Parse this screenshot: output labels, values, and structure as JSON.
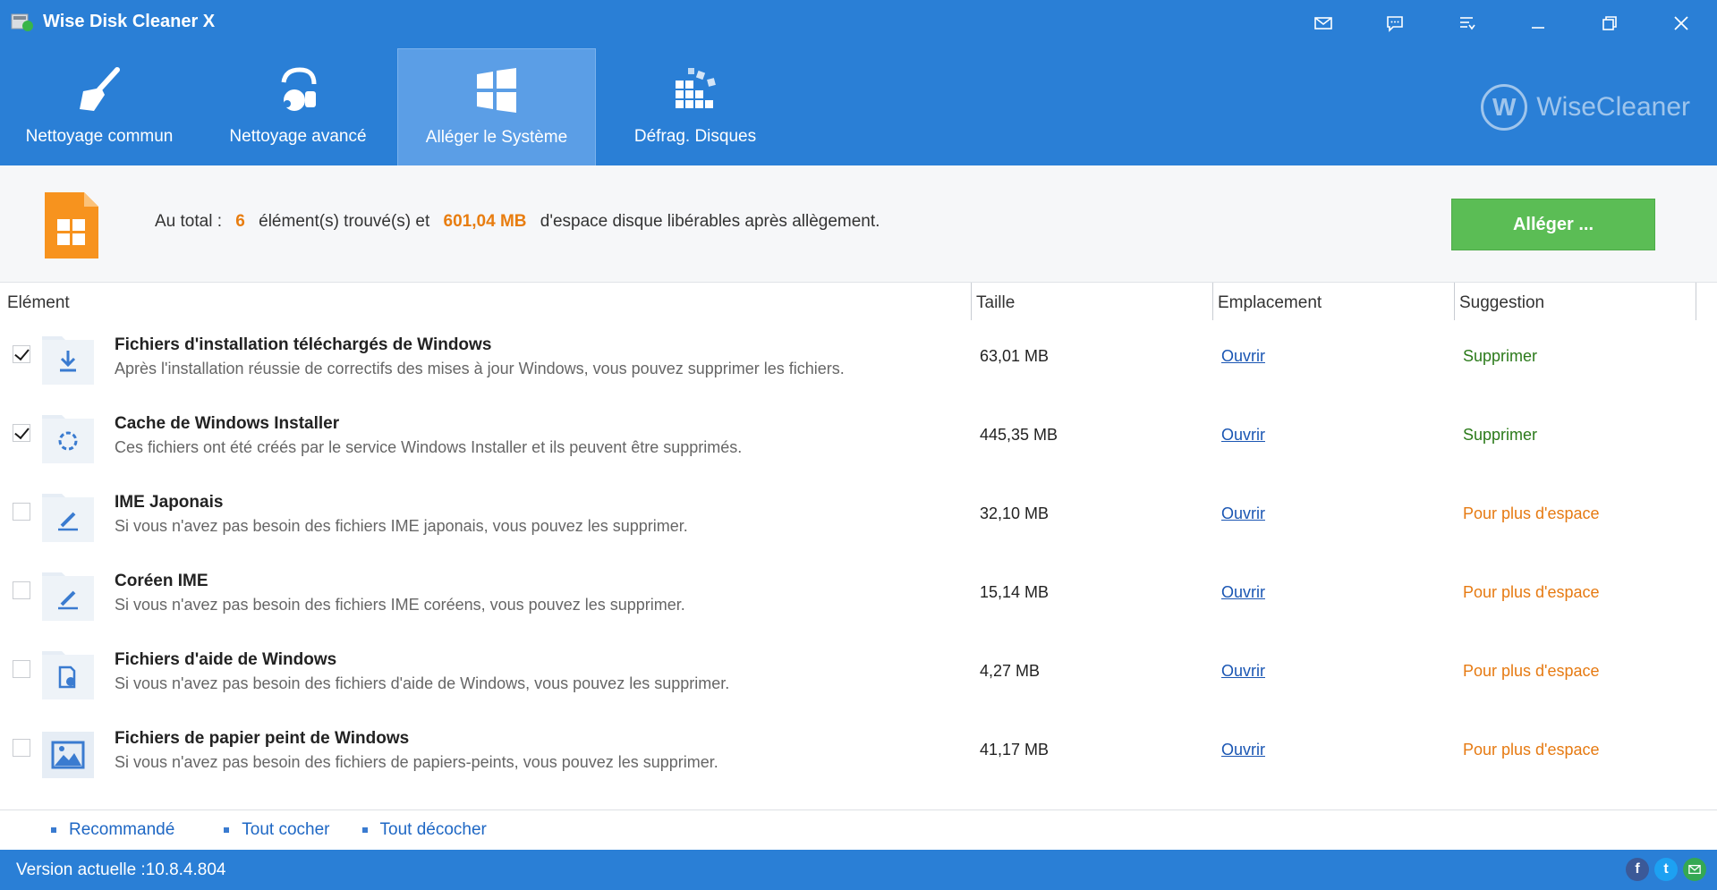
{
  "window": {
    "title": "Wise Disk Cleaner X",
    "controls": [
      "mail-icon",
      "feedback-icon",
      "menu-icon",
      "minimize-icon",
      "restore-icon",
      "close-icon"
    ]
  },
  "tabs": [
    {
      "label": "Nettoyage commun",
      "icon": "broom-icon",
      "active": false
    },
    {
      "label": "Nettoyage avancé",
      "icon": "vacuum-icon",
      "active": false
    },
    {
      "label": "Alléger le Système",
      "icon": "windows-icon",
      "active": true
    },
    {
      "label": "Défrag. Disques",
      "icon": "defrag-icon",
      "active": false
    }
  ],
  "brand": {
    "logo_letter": "W",
    "name": "WiseCleaner"
  },
  "summary": {
    "prefix": "Au total :",
    "count": "6",
    "middle": "élément(s) trouvé(s) et",
    "size": "601,04 MB",
    "suffix": "d'espace disque libérables après allègement.",
    "button": "Alléger ..."
  },
  "table": {
    "headers": {
      "element": "Elément",
      "size": "Taille",
      "location": "Emplacement",
      "suggestion": "Suggestion"
    },
    "rows": [
      {
        "checked": true,
        "icon": "download-icon",
        "title": "Fichiers d'installation téléchargés de Windows",
        "desc": "Après l'installation réussie de correctifs des mises à jour Windows, vous pouvez supprimer les fichiers.",
        "size": "63,01 MB",
        "location": "Ouvrir",
        "suggestion": "Supprimer",
        "suggestion_type": "green"
      },
      {
        "checked": true,
        "icon": "installer-icon",
        "title": "Cache de Windows Installer",
        "desc": "Ces fichiers ont été créés par le service Windows Installer et ils peuvent être supprimés.",
        "size": "445,35 MB",
        "location": "Ouvrir",
        "suggestion": "Supprimer",
        "suggestion_type": "green"
      },
      {
        "checked": false,
        "icon": "pen-icon",
        "title": "IME Japonais",
        "desc": "Si vous n'avez pas besoin des fichiers IME japonais, vous pouvez les supprimer.",
        "size": "32,10 MB",
        "location": "Ouvrir",
        "suggestion": "Pour plus d'espace",
        "suggestion_type": "orange"
      },
      {
        "checked": false,
        "icon": "pen-icon",
        "title": "Coréen IME",
        "desc": "Si vous n'avez pas besoin des fichiers IME coréens, vous pouvez les supprimer.",
        "size": "15,14 MB",
        "location": "Ouvrir",
        "suggestion": "Pour plus d'espace",
        "suggestion_type": "orange"
      },
      {
        "checked": false,
        "icon": "help-file-icon",
        "title": "Fichiers d'aide de Windows",
        "desc": "Si vous n'avez pas besoin des fichiers d'aide de Windows, vous pouvez les supprimer.",
        "size": "4,27 MB",
        "location": "Ouvrir",
        "suggestion": "Pour plus d'espace",
        "suggestion_type": "orange"
      },
      {
        "checked": false,
        "icon": "wallpaper-icon",
        "title": "Fichiers de papier peint de Windows",
        "desc": "Si vous n'avez pas besoin des fichiers de papiers-peints, vous pouvez les supprimer.",
        "size": "41,17 MB",
        "location": "Ouvrir",
        "suggestion": "Pour plus d'espace",
        "suggestion_type": "orange"
      }
    ]
  },
  "footer": {
    "links": [
      "Recommandé",
      "Tout cocher",
      "Tout décocher"
    ],
    "version": "Version actuelle :10.8.4.804",
    "social": [
      "facebook-icon",
      "twitter-icon",
      "email-icon"
    ]
  },
  "colors": {
    "header": "#2a7fd6",
    "button_green": "#5bbd55",
    "accent_orange": "#e87d10"
  }
}
